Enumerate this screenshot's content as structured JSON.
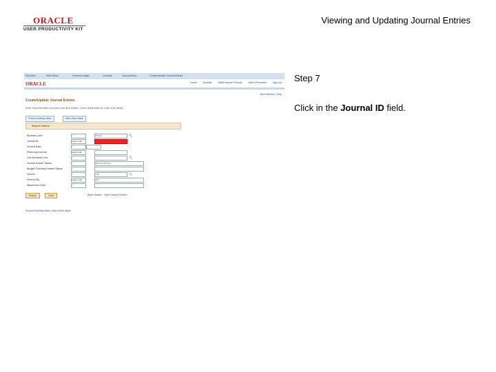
{
  "header": {
    "logo_brand": "ORACLE",
    "logo_product": "USER PRODUCTIVITY KIT",
    "doc_title": "Viewing and Updating Journal Entries"
  },
  "step": {
    "label": "Step 7",
    "instruction_prefix": "Click in the ",
    "instruction_target": "Journal ID",
    "instruction_suffix": " field."
  },
  "screenshot": {
    "breadcrumbs": [
      "Favorites",
      "Main Menu",
      "General Ledger",
      "Journals",
      "Journal Entry",
      "Create/Update Journal Entries"
    ],
    "brand": "ORACLE",
    "top_links": [
      "Home",
      "Worklist",
      "MultiChannel Console",
      "Add to Favorites",
      "Sign out"
    ],
    "new_window": "New Window | Help",
    "page_title": "Create/Update Journal Entries",
    "subtitle": "Enter any information you have and click Search. Leave fields blank for a list of all values.",
    "tabs": [
      "Find an Existing Value",
      "Add a New Value"
    ],
    "criteria_heading": "Search Criteria",
    "fields": [
      {
        "label": "Business Unit:",
        "op": "=",
        "value": "US001"
      },
      {
        "label": "Journal ID:",
        "op": "begins with",
        "value": ""
      },
      {
        "label": "Journal Date:",
        "op": "=",
        "value": ""
      },
      {
        "label": "Recurring Journal:",
        "op": "begins with",
        "value": ""
      },
      {
        "label": "Line Business Unit:",
        "op": "=",
        "value": ""
      },
      {
        "label": "Journal Header Status:",
        "op": "=",
        "value": "Valid and Posted"
      },
      {
        "label": "Budget Checking Header Status:",
        "op": "=",
        "value": ""
      },
      {
        "label": "Source:",
        "op": "=",
        "value": "ONL"
      },
      {
        "label": "Entered By:",
        "op": "begins with",
        "value": "VP1"
      },
      {
        "label": "Attachment Exist:",
        "op": "=",
        "value": ""
      }
    ],
    "buttons": {
      "search": "Search",
      "clear": "Clear"
    },
    "basic_search": "Basic Search",
    "save_criteria": "Save Search Criteria",
    "footer": "Find an Existing Value | Add a New Value"
  }
}
